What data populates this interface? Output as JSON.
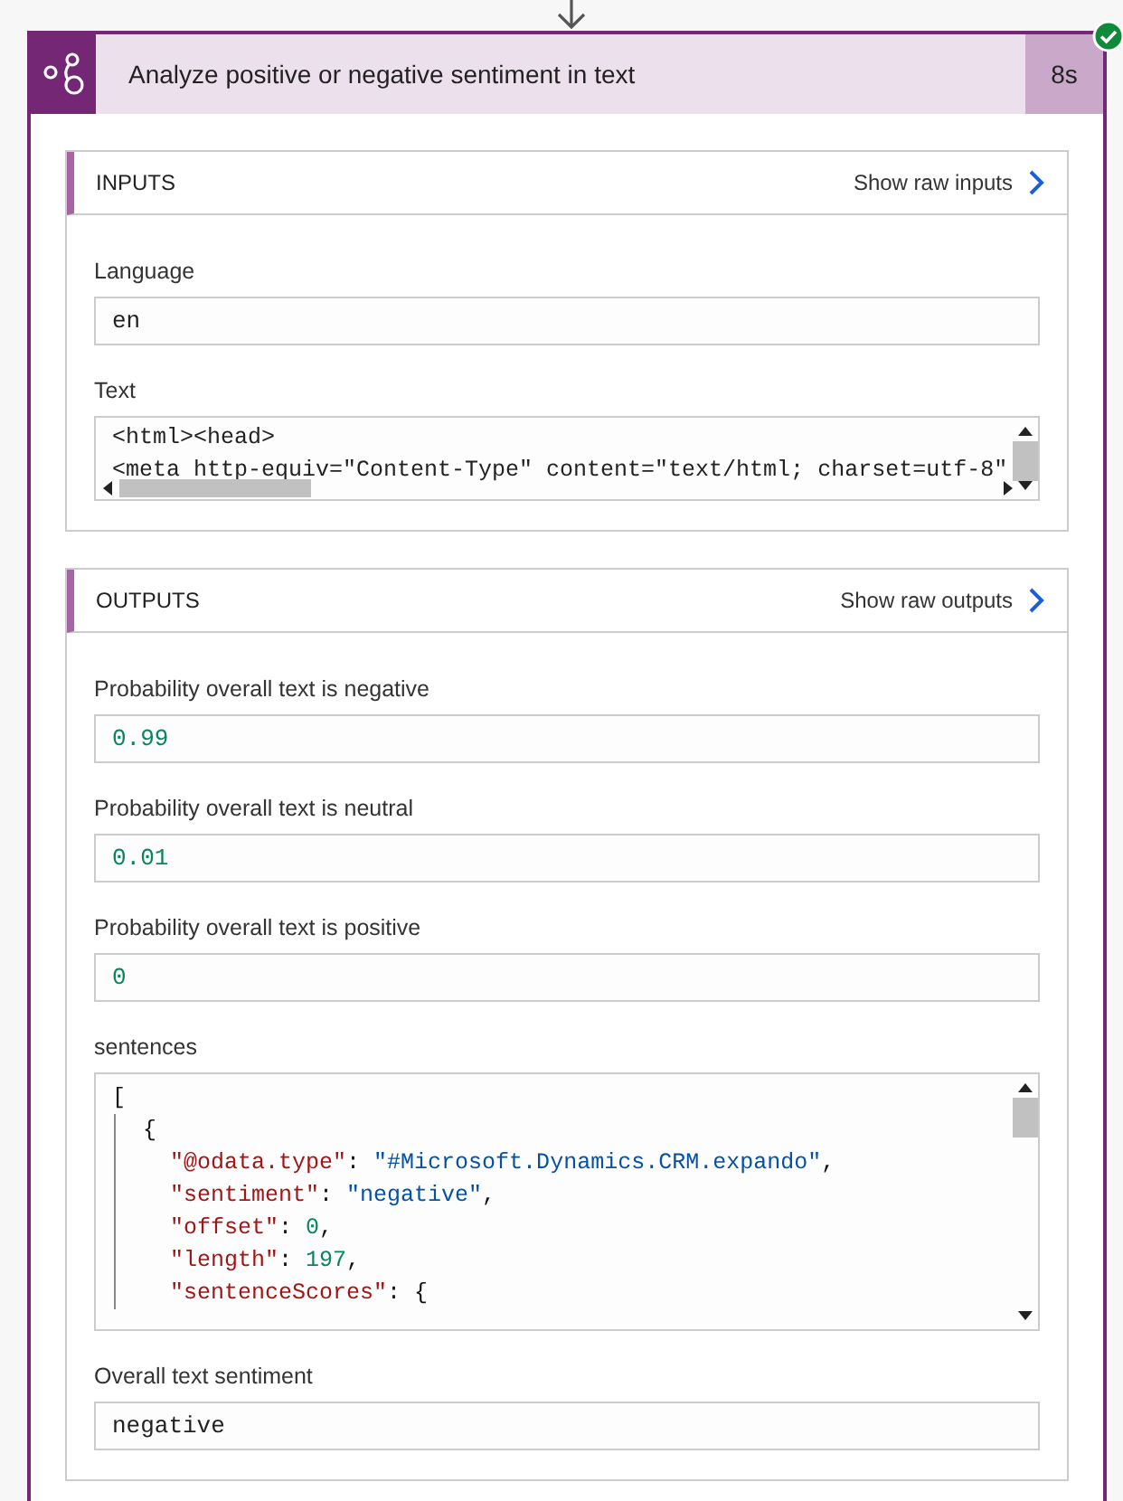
{
  "action": {
    "title": "Analyze positive or negative sentiment in text",
    "duration": "8s",
    "succeeded": true
  },
  "inputs": {
    "title": "INPUTS",
    "link": "Show raw inputs",
    "fields": [
      {
        "label": "Language",
        "kind": "text",
        "value": "en"
      },
      {
        "label": "Text",
        "kind": "multiline",
        "lines": [
          "<html><head>",
          "<meta http-equiv=\"Content-Type\" content=\"text/html; charset=utf-8\""
        ]
      }
    ]
  },
  "outputs": {
    "title": "OUTPUTS",
    "link": "Show raw outputs",
    "fields": [
      {
        "label": "Probability overall text is negative",
        "kind": "number",
        "value": "0.99"
      },
      {
        "label": "Probability overall text is neutral",
        "kind": "number",
        "value": "0.01"
      },
      {
        "label": "Probability overall text is positive",
        "kind": "number",
        "value": "0"
      },
      {
        "label": "sentences",
        "kind": "json",
        "code": [
          {
            "tokens": [
              {
                "kind": "punct",
                "text": "["
              }
            ],
            "children": [
              {
                "tokens": [
                  {
                    "kind": "punct",
                    "text": "{"
                  }
                ],
                "children": [
                  {
                    "tokens": [
                      {
                        "kind": "key",
                        "text": "\"@odata.type\""
                      },
                      {
                        "kind": "punct",
                        "text": ": "
                      },
                      {
                        "kind": "string",
                        "text": "\"#Microsoft.Dynamics.CRM.expando\""
                      },
                      {
                        "kind": "punct",
                        "text": ","
                      }
                    ]
                  },
                  {
                    "tokens": [
                      {
                        "kind": "key",
                        "text": "\"sentiment\""
                      },
                      {
                        "kind": "punct",
                        "text": ": "
                      },
                      {
                        "kind": "string",
                        "text": "\"negative\""
                      },
                      {
                        "kind": "punct",
                        "text": ","
                      }
                    ]
                  },
                  {
                    "tokens": [
                      {
                        "kind": "key",
                        "text": "\"offset\""
                      },
                      {
                        "kind": "punct",
                        "text": ": "
                      },
                      {
                        "kind": "number",
                        "text": "0"
                      },
                      {
                        "kind": "punct",
                        "text": ","
                      }
                    ]
                  },
                  {
                    "tokens": [
                      {
                        "kind": "key",
                        "text": "\"length\""
                      },
                      {
                        "kind": "punct",
                        "text": ": "
                      },
                      {
                        "kind": "number",
                        "text": "197"
                      },
                      {
                        "kind": "punct",
                        "text": ","
                      }
                    ]
                  },
                  {
                    "tokens": [
                      {
                        "kind": "key",
                        "text": "\"sentenceScores\""
                      },
                      {
                        "kind": "punct",
                        "text": ": {"
                      }
                    ]
                  }
                ]
              }
            ]
          }
        ]
      },
      {
        "label": "Overall text sentiment",
        "kind": "text",
        "value": "negative"
      }
    ]
  }
}
